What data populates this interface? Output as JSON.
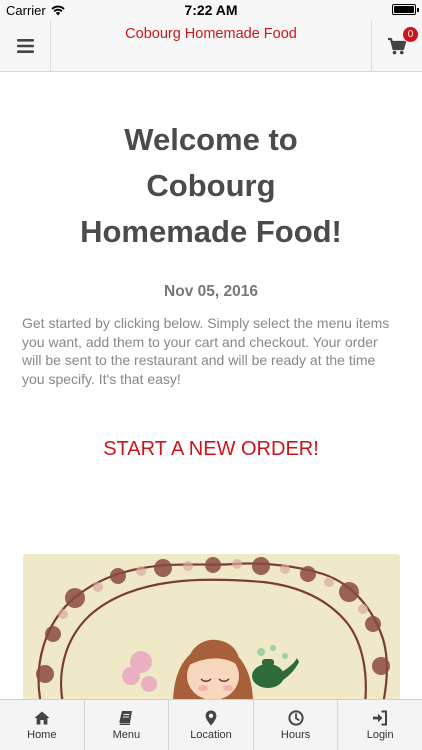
{
  "status_bar": {
    "carrier": "Carrier",
    "time": "7:22 AM",
    "wifi_icon": "wifi-icon",
    "battery_icon": "battery-icon"
  },
  "header": {
    "title": "Cobourg Homemade Food",
    "menu_icon": "hamburger-icon",
    "cart_icon": "cart-icon",
    "cart_count": "0",
    "accent_color": "#c8191e"
  },
  "main": {
    "welcome_line1": "Welcome to",
    "welcome_line2": "Cobourg",
    "welcome_line3": "Homemade Food!",
    "date": "Nov 05, 2016",
    "intro": "Get started by clicking below. Simply select the menu items you want, add them to your cart and checkout. Your order will be sent to the restaurant and will be ready at the time you specify. It's that easy!",
    "start_order_label": "START A NEW ORDER!"
  },
  "bottom_nav": {
    "items": [
      {
        "label": "Home",
        "icon": "home-icon"
      },
      {
        "label": "Menu",
        "icon": "book-icon"
      },
      {
        "label": "Location",
        "icon": "map-marker-icon"
      },
      {
        "label": "Hours",
        "icon": "clock-icon"
      },
      {
        "label": "Login",
        "icon": "sign-in-icon"
      }
    ]
  }
}
